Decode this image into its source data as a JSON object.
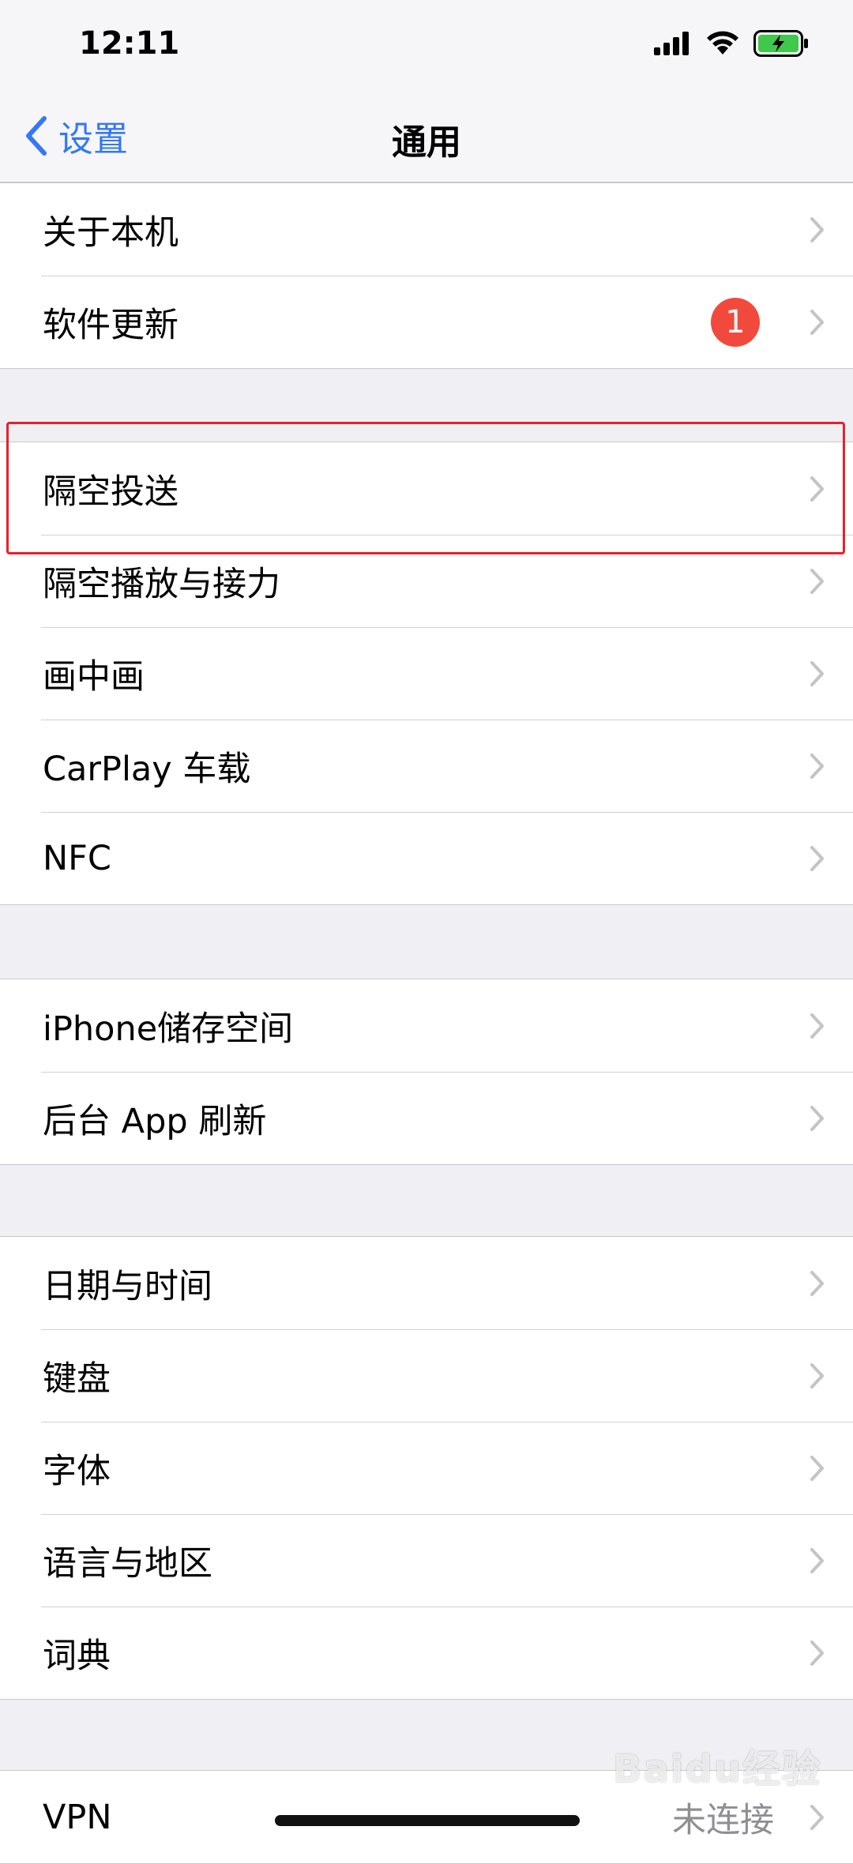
{
  "status": {
    "time": "12:11",
    "icons": [
      "signal-icon",
      "wifi-icon",
      "battery-charging-icon"
    ],
    "battery_color": "#3fc84b"
  },
  "nav": {
    "back_label": "设置",
    "title": "通用",
    "accent": "#3478f6"
  },
  "groups": [
    {
      "items": [
        {
          "label": "关于本机"
        },
        {
          "label": "软件更新",
          "badge": "1"
        }
      ]
    },
    {
      "items": [
        {
          "label": "隔空投送"
        },
        {
          "label": "隔空播放与接力"
        },
        {
          "label": "画中画"
        },
        {
          "label": "CarPlay 车载"
        },
        {
          "label": "NFC"
        }
      ]
    },
    {
      "items": [
        {
          "label": "iPhone储存空间"
        },
        {
          "label": "后台 App 刷新"
        }
      ]
    },
    {
      "items": [
        {
          "label": "日期与时间"
        },
        {
          "label": "键盘"
        },
        {
          "label": "字体"
        },
        {
          "label": "语言与地区"
        },
        {
          "label": "词典"
        }
      ]
    },
    {
      "items": [
        {
          "label": "VPN",
          "value": "未连接"
        }
      ]
    }
  ],
  "watermark": "Baidu经验",
  "highlight_color": "#e8202b"
}
